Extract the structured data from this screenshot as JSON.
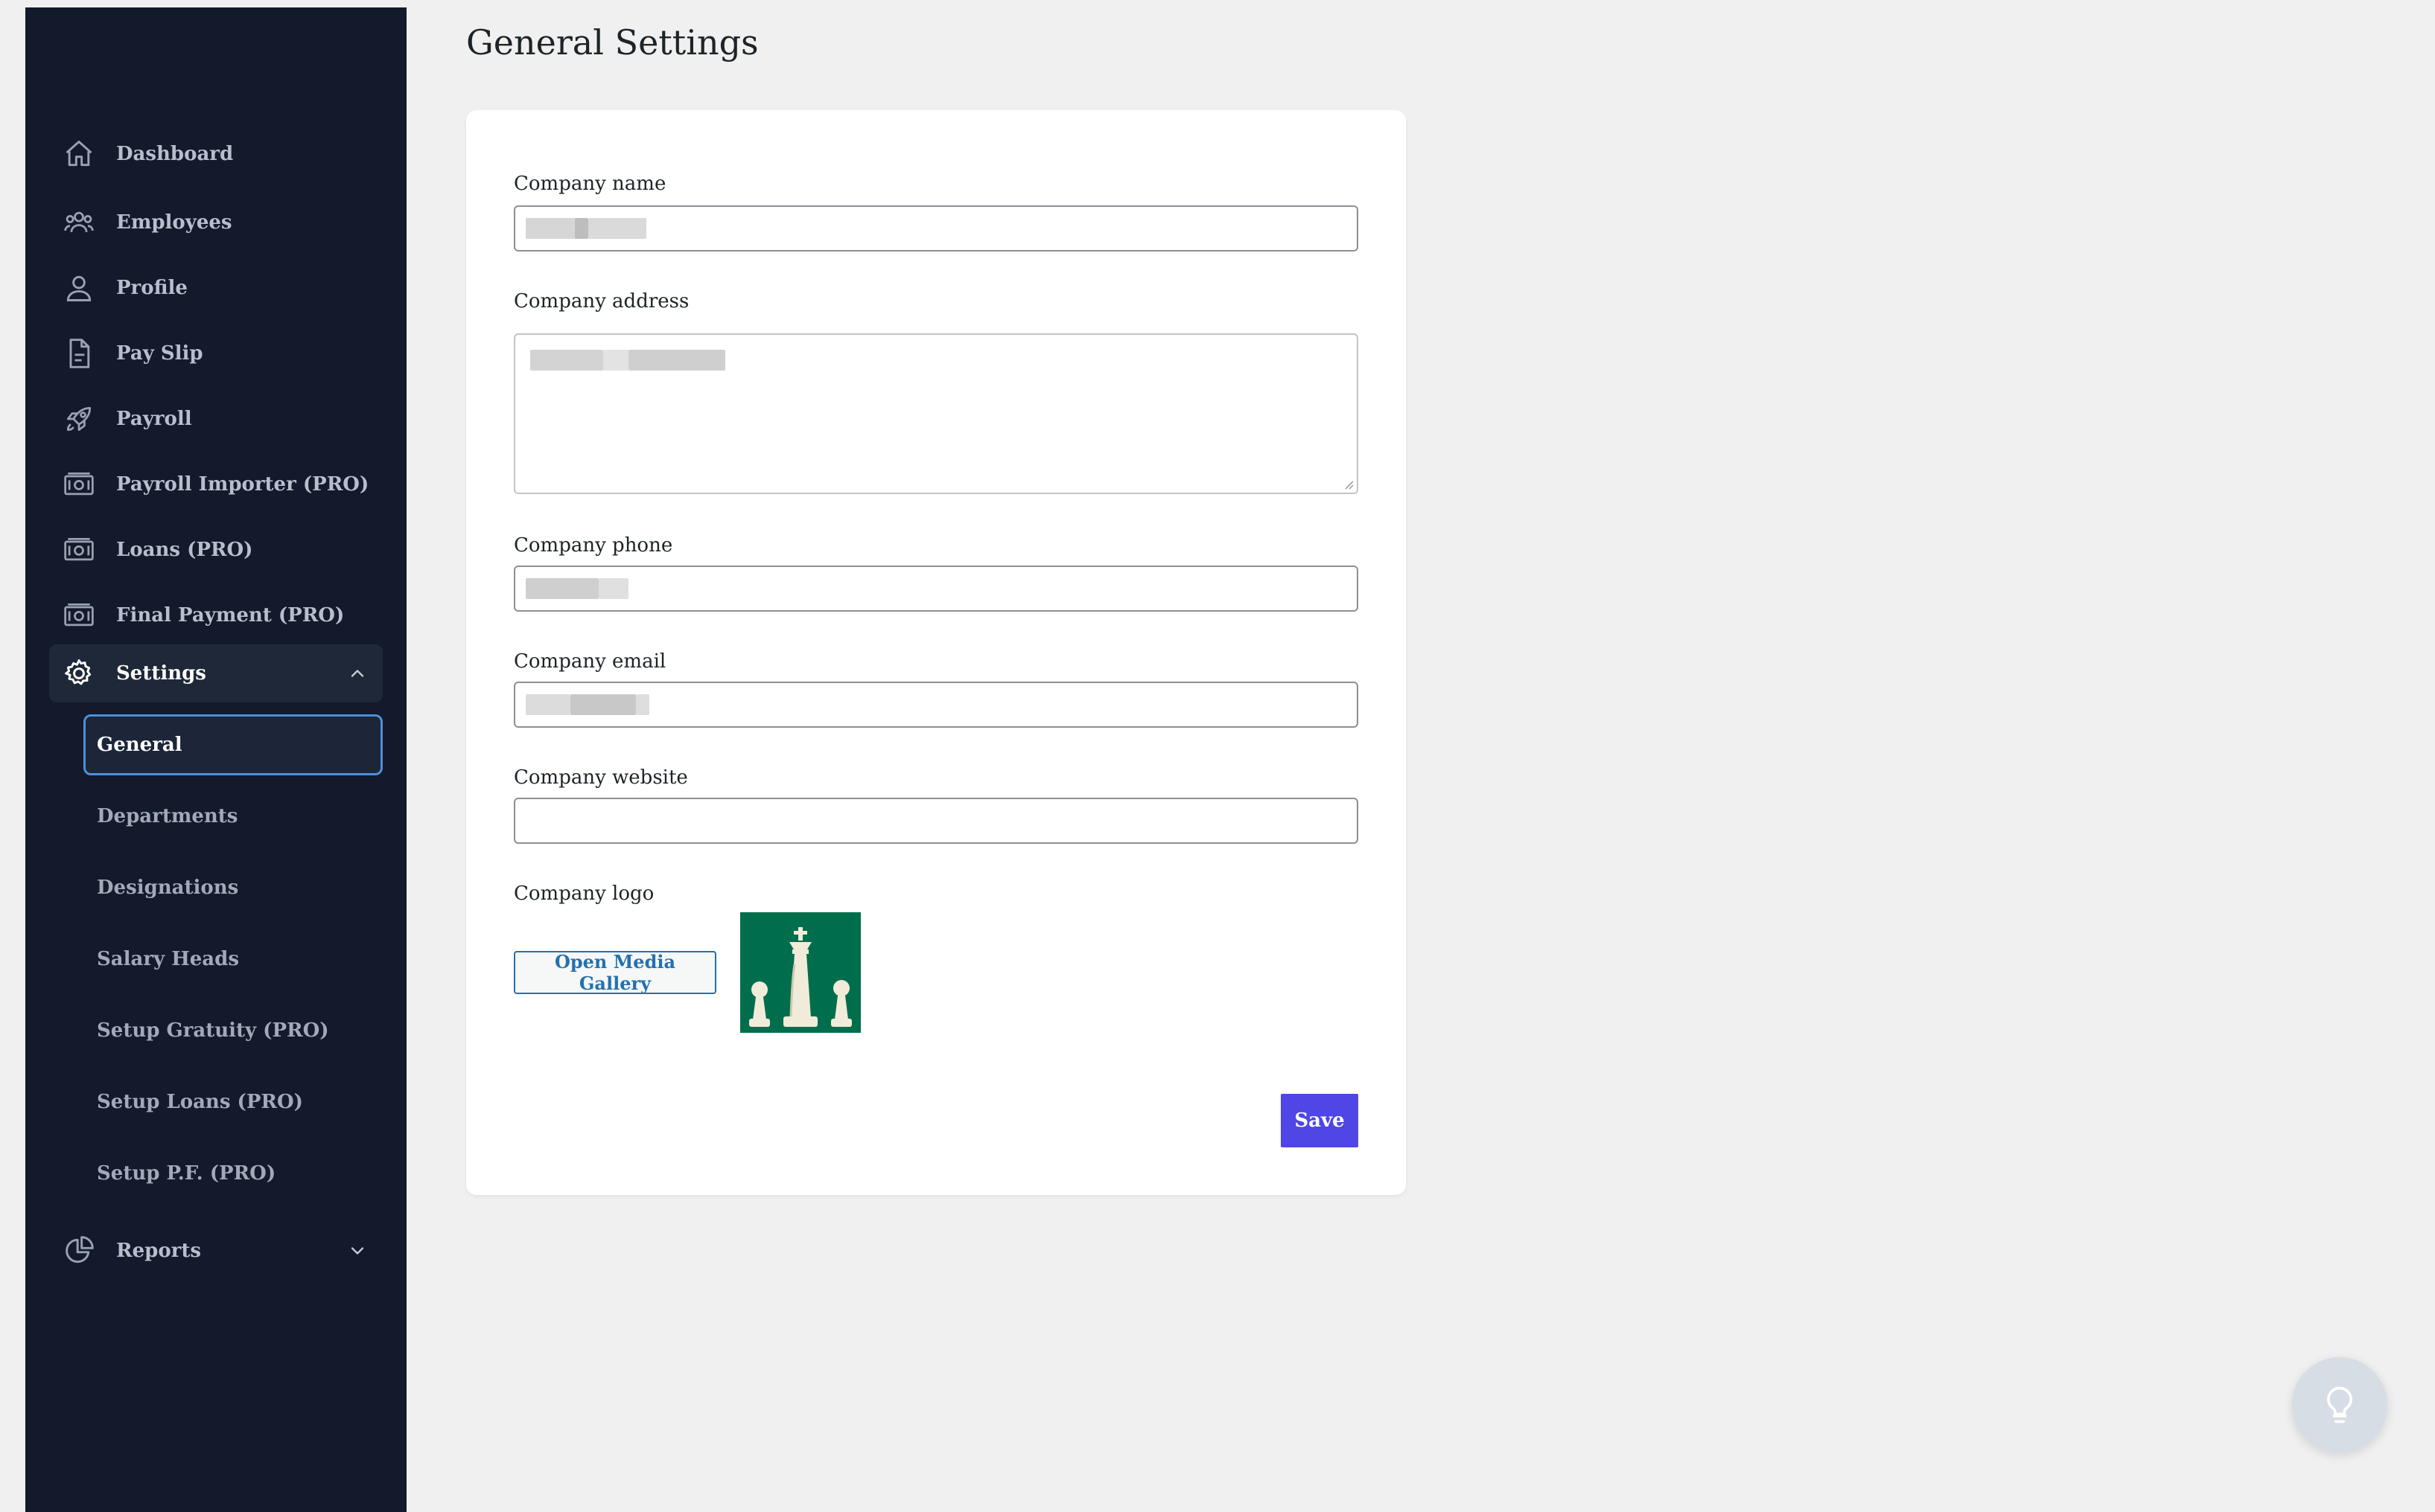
{
  "sidebar": {
    "items": [
      {
        "label": "Dashboard",
        "icon": "home-icon"
      },
      {
        "label": "Employees",
        "icon": "users-icon"
      },
      {
        "label": "Profile",
        "icon": "user-icon"
      },
      {
        "label": "Pay Slip",
        "icon": "document-icon"
      },
      {
        "label": "Payroll",
        "icon": "rocket-icon"
      },
      {
        "label": "Payroll Importer (PRO)",
        "icon": "banknote-icon"
      },
      {
        "label": "Loans (PRO)",
        "icon": "banknote-icon"
      },
      {
        "label": "Final Payment (PRO)",
        "icon": "banknote-icon"
      },
      {
        "label": "Settings",
        "icon": "gear-icon",
        "expanded": true
      },
      {
        "label": "Reports",
        "icon": "pie-chart-icon",
        "expanded": false
      }
    ],
    "settings_submenu": [
      {
        "label": "General",
        "selected": true
      },
      {
        "label": "Departments"
      },
      {
        "label": "Designations"
      },
      {
        "label": "Salary Heads"
      },
      {
        "label": "Setup Gratuity (PRO)"
      },
      {
        "label": "Setup Loans (PRO)"
      },
      {
        "label": "Setup P.F. (PRO)"
      }
    ]
  },
  "page": {
    "title": "General Settings"
  },
  "form": {
    "company_name_label": "Company name",
    "company_address_label": "Company address",
    "company_phone_label": "Company phone",
    "company_email_label": "Company email",
    "company_website_label": "Company website",
    "company_website_value": "",
    "company_logo_label": "Company logo",
    "media_button_label": "Open Media Gallery",
    "save_button_label": "Save"
  },
  "colors": {
    "sidebar_bg": "#121a2b",
    "accent": "#4f46e5",
    "link": "#2271b1",
    "logo_bg": "#006e4c"
  }
}
